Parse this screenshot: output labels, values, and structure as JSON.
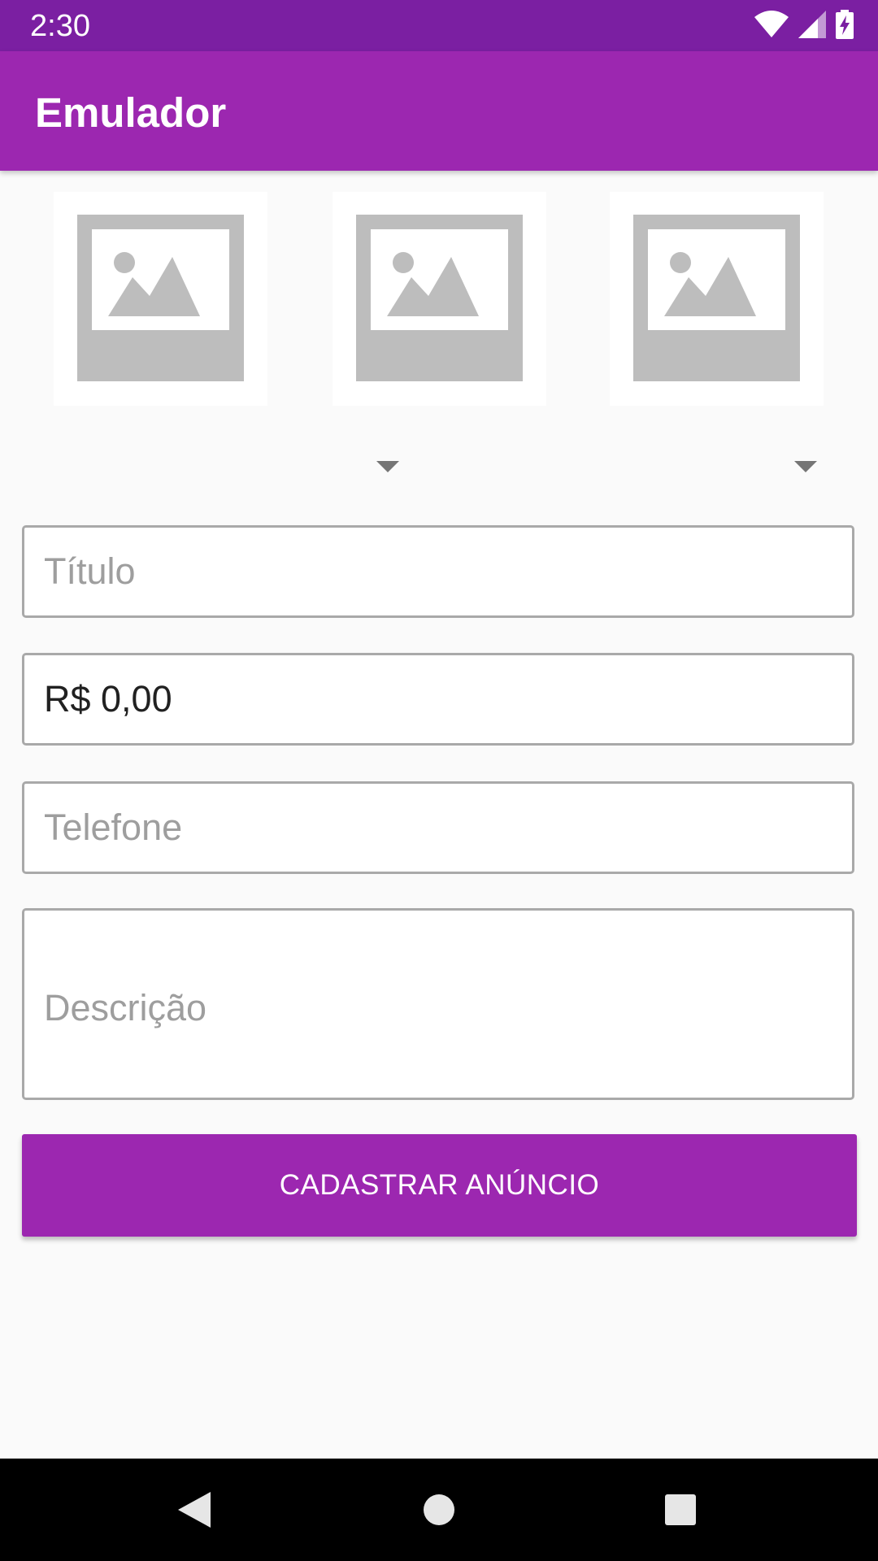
{
  "status_bar": {
    "time": "2:30",
    "icons": [
      "wifi-icon",
      "cell-signal-icon",
      "battery-charging-icon"
    ]
  },
  "app_bar": {
    "title": "Emulador"
  },
  "images": [
    {
      "icon": "image-placeholder-icon"
    },
    {
      "icon": "image-placeholder-icon"
    },
    {
      "icon": "image-placeholder-icon"
    }
  ],
  "spinners": [
    {
      "selected": ""
    },
    {
      "selected": ""
    }
  ],
  "form": {
    "titulo": {
      "value": "",
      "placeholder": "Título"
    },
    "preco": {
      "value": "R$ 0,00",
      "placeholder": ""
    },
    "telefone": {
      "value": "",
      "placeholder": "Telefone"
    },
    "descricao": {
      "value": "",
      "placeholder": "Descrição"
    },
    "submit_label": "CADASTRAR ANÚNCIO"
  },
  "nav_bar": {
    "icons": [
      "back-icon",
      "home-icon",
      "recents-icon"
    ]
  },
  "colors": {
    "status_bar": "#7b1fa2",
    "primary": "#9c27b0",
    "background": "#fafafa",
    "placeholder_image": "#bdbdbd"
  }
}
